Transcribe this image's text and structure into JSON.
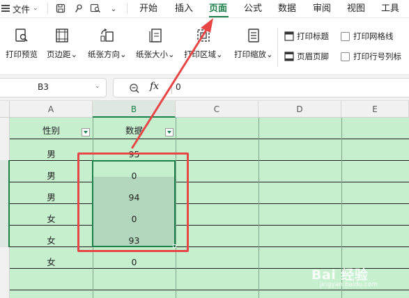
{
  "menubar": {
    "file_label": "文件",
    "tabs": [
      {
        "label": "开始"
      },
      {
        "label": "插入"
      },
      {
        "label": "页面"
      },
      {
        "label": "公式"
      },
      {
        "label": "数据"
      },
      {
        "label": "审阅"
      },
      {
        "label": "视图"
      },
      {
        "label": "工具"
      }
    ],
    "active_tab": "页面",
    "quick_access_icons": [
      "save-icon",
      "format-painter-icon",
      "print-preview-quick-icon",
      "more-chevron-icon"
    ],
    "accent_color": "#1b7f4a"
  },
  "ribbon": {
    "buttons": [
      {
        "label": "打印预览",
        "icon": "print-preview-icon"
      },
      {
        "label": "页边距",
        "icon": "margins-icon",
        "has_dropdown": true
      },
      {
        "label": "纸张方向",
        "icon": "orientation-icon",
        "has_dropdown": true
      },
      {
        "label": "纸张大小",
        "icon": "paper-size-icon",
        "has_dropdown": true
      },
      {
        "label": "打印区域",
        "icon": "print-area-icon",
        "has_dropdown": true
      },
      {
        "label": "打印缩放",
        "icon": "print-scale-icon",
        "has_dropdown": true
      }
    ],
    "dropdown_glyph": "⌄",
    "small_buttons": [
      {
        "label": "打印标题",
        "icon": "print-titles-icon"
      },
      {
        "label": "页眉页脚",
        "icon": "header-footer-icon"
      }
    ],
    "checkboxes": [
      {
        "label": "打印网格线",
        "checked": false
      },
      {
        "label": "打印行号列标",
        "checked": false
      }
    ]
  },
  "formula_bar": {
    "name_box": "B3",
    "fx_label": "fx",
    "value": "0"
  },
  "sheet": {
    "columns": [
      "A",
      "B",
      "C",
      "D",
      "E"
    ],
    "selected_column": "B",
    "header_row": {
      "a": "性别",
      "b": "数据"
    },
    "rows": [
      {
        "a": "男",
        "b": "95"
      },
      {
        "a": "男",
        "b": "0"
      },
      {
        "a": "男",
        "b": "94"
      },
      {
        "a": "女",
        "b": "0"
      },
      {
        "a": "女",
        "b": "93"
      },
      {
        "a": "女",
        "b": "0"
      }
    ],
    "cell_fill_color": "#c6efce",
    "selection_color": "#1b7f4a",
    "annotation_color": "#e84545"
  },
  "watermark": {
    "brand": "Bai 经验",
    "url": "jingyan.baidu.com"
  }
}
